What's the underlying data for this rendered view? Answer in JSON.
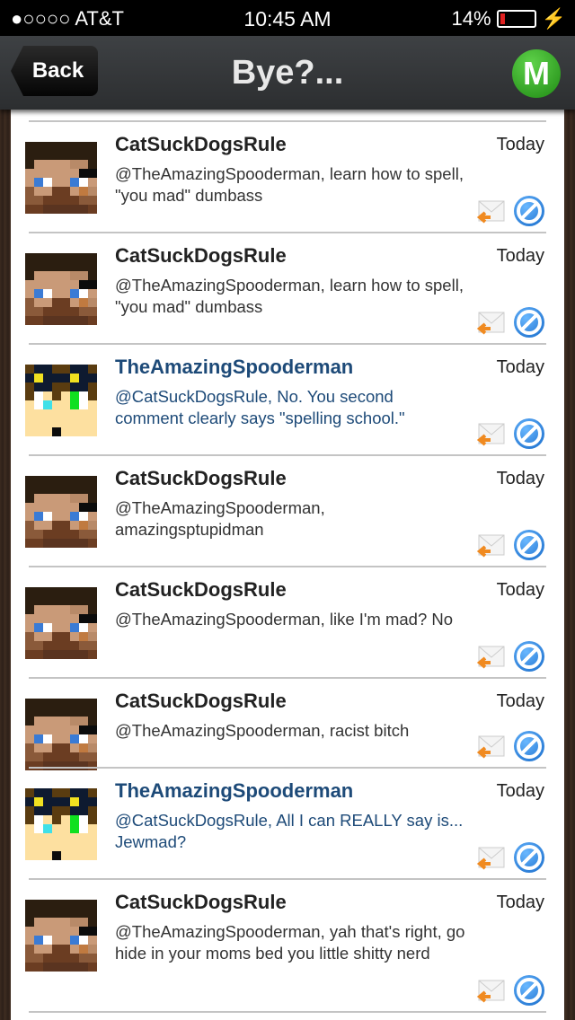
{
  "status_bar": {
    "carrier": "●○○○○ AT&T",
    "time": "10:45 AM",
    "battery": "14%"
  },
  "nav": {
    "back_label": "Back",
    "title": "Bye?...",
    "menu_label": "M"
  },
  "comments": [
    {
      "author": "CatSuckDogsRule",
      "date": "Today",
      "text": "@TheAmazingSpooderman, learn how to spell, \"you mad\" dumbass",
      "avatar": "steve"
    },
    {
      "author": "CatSuckDogsRule",
      "date": "Today",
      "text": "@TheAmazingSpooderman, learn how to spell, \"you mad\" dumbass",
      "avatar": "steve"
    },
    {
      "author": "TheAmazingSpooderman",
      "date": "Today",
      "text": "@CatSuckDogsRule, No. You second comment clearly says \"spelling school.\"",
      "avatar": "spood"
    },
    {
      "author": "CatSuckDogsRule",
      "date": "Today",
      "text": "@TheAmazingSpooderman, amazingsptupidman",
      "avatar": "steve"
    },
    {
      "author": "CatSuckDogsRule",
      "date": "Today",
      "text": "@TheAmazingSpooderman, like I'm mad? No",
      "avatar": "steve"
    },
    {
      "author": "CatSuckDogsRule",
      "date": "Today",
      "text": "@TheAmazingSpooderman, racist bitch",
      "avatar": "steve"
    },
    {
      "author": "TheAmazingSpooderman",
      "date": "Today",
      "text": "@CatSuckDogsRule, All I can REALLY say is... Jewmad?",
      "avatar": "spood"
    },
    {
      "author": "CatSuckDogsRule",
      "date": "Today",
      "text": "@TheAmazingSpooderman, yah that's right, go hide in your moms bed you little shitty nerd",
      "avatar": "steve"
    }
  ]
}
